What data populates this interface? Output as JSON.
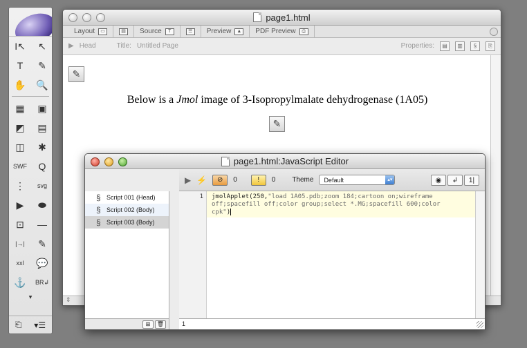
{
  "palette": {
    "tools": [
      {
        "icon": "select-arrow-icon",
        "glyph": "I↖"
      },
      {
        "icon": "direct-select-icon",
        "glyph": "↖"
      },
      {
        "icon": "text-tool-icon",
        "glyph": "T"
      },
      {
        "icon": "eyedropper-icon",
        "glyph": "✎"
      },
      {
        "icon": "hand-tool-icon",
        "glyph": "✋"
      },
      {
        "icon": "zoom-tool-icon",
        "glyph": "🔍"
      }
    ],
    "objects": [
      {
        "icon": "table-icon",
        "glyph": "▦"
      },
      {
        "icon": "layout-box-icon",
        "glyph": "▣"
      },
      {
        "icon": "image-icon",
        "glyph": "◩"
      },
      {
        "icon": "list-icon",
        "glyph": "▤"
      },
      {
        "icon": "form-icon",
        "glyph": "◫"
      },
      {
        "icon": "plugin-icon",
        "glyph": "✱"
      },
      {
        "icon": "swf-icon",
        "glyph": "SWF"
      },
      {
        "icon": "quicktime-icon",
        "glyph": "Q"
      },
      {
        "icon": "applet-icon",
        "glyph": "⋮"
      },
      {
        "icon": "svg-icon",
        "glyph": "svg"
      },
      {
        "icon": "media-play-icon",
        "glyph": "▶"
      },
      {
        "icon": "capsule-icon",
        "glyph": "⬬"
      },
      {
        "icon": "input-field-icon",
        "glyph": "⊡"
      },
      {
        "icon": "horizontal-rule-icon",
        "glyph": "—"
      },
      {
        "icon": "anchor-jump-icon",
        "glyph": "|→|"
      },
      {
        "icon": "javascript-icon",
        "glyph": "✎"
      },
      {
        "icon": "server-side-icon",
        "glyph": "xxl"
      },
      {
        "icon": "comment-icon",
        "glyph": "💬"
      },
      {
        "icon": "anchor-icon",
        "glyph": "⚓"
      },
      {
        "icon": "line-break-icon",
        "glyph": "BR↲"
      }
    ],
    "more": "▾",
    "bottom_left": "⎗",
    "bottom_right": "▾☰"
  },
  "doc_window": {
    "title": "page1.html",
    "modes": [
      {
        "label": "Layout",
        "icon": "▭",
        "name": "layout"
      },
      {
        "label": "",
        "icon": "▤",
        "name": "frames"
      },
      {
        "label": "Source",
        "icon": "T",
        "name": "source"
      },
      {
        "label": "",
        "icon": "☰",
        "name": "outline"
      },
      {
        "label": "Preview",
        "icon": "▲",
        "name": "preview"
      },
      {
        "label": "PDF Preview",
        "icon": "⎙",
        "name": "pdf-preview"
      }
    ],
    "head_label": "Head",
    "page_title_label": "Title:",
    "page_title_value": "Untitled Page",
    "properties_label": "Properties:",
    "headline_prefix": "Below is a ",
    "headline_italic": "Jmol",
    "headline_suffix": " image of 3-Isopropylmalate dehydrogenase (1A05)",
    "status": "⇕"
  },
  "js_editor": {
    "title": "page1.html:JavaScript Editor",
    "error_count": "0",
    "warning_count": "0",
    "theme_label": "Theme",
    "theme_value": "Default",
    "scripts": [
      {
        "label": "Script 001 (Head)"
      },
      {
        "label": "Script 002 (Body)"
      },
      {
        "label": "Script 003 (Body)"
      }
    ],
    "line_number": "1",
    "code_fn": "jmolApplet(250,",
    "code_str": "\"load 1A05.pdb;zoom 184;cartoon on;wireframe\noff;spacefill off;color group;select *.MG;spacefill 600;color\ncpk\"",
    "code_end": ")",
    "status_line": "1"
  }
}
